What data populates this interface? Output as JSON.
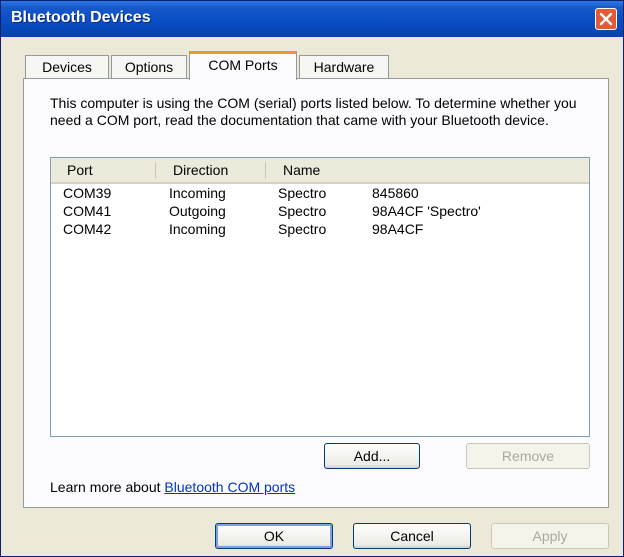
{
  "window": {
    "title": "Bluetooth Devices"
  },
  "tabs": [
    {
      "label": "Devices"
    },
    {
      "label": "Options"
    },
    {
      "label": "COM Ports",
      "active": true
    },
    {
      "label": "Hardware"
    }
  ],
  "description": "This computer is using the COM (serial) ports listed below. To determine whether you need a COM port, read the documentation that came with your Bluetooth device.",
  "ports_list": {
    "columns": [
      "Port",
      "Direction",
      "Name"
    ],
    "rows": [
      {
        "port": "COM39",
        "direction": "Incoming",
        "name": "Spectro",
        "device": "845860"
      },
      {
        "port": "COM41",
        "direction": "Outgoing",
        "name": "Spectro",
        "device": "98A4CF 'Spectro'"
      },
      {
        "port": "COM42",
        "direction": "Incoming",
        "name": "Spectro",
        "device": "98A4CF"
      }
    ]
  },
  "list_buttons": {
    "add": "Add...",
    "remove": "Remove"
  },
  "learn_more": {
    "prefix": "Learn more about ",
    "link": "Bluetooth COM ports"
  },
  "dialog_buttons": {
    "ok": "OK",
    "cancel": "Cancel",
    "apply": "Apply"
  },
  "colors": {
    "titlebar": "#0a4ec6",
    "close": "#e35a35",
    "tab_accent": "#e69a2f",
    "link": "#0033cc"
  },
  "icons": {
    "close": "close-icon"
  }
}
